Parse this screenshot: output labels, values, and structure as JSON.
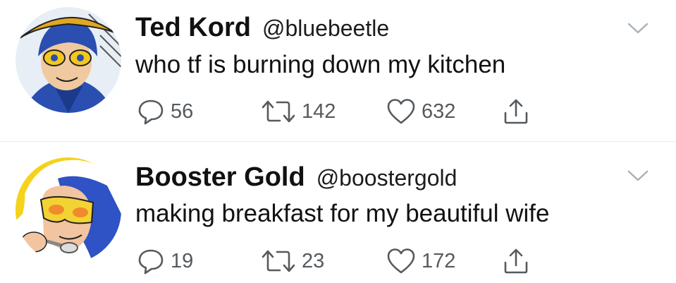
{
  "tweets": [
    {
      "display_name": "Ted Kord",
      "handle": "@bluebeetle",
      "text": "who tf is burning down my kitchen",
      "replies": "56",
      "retweets": "142",
      "likes": "632",
      "avatar_colors": {
        "bg": "#e8eef5",
        "mask": "#f2c81f",
        "suit": "#2a4fb0",
        "skin": "#f1c9a0"
      }
    },
    {
      "display_name": "Booster Gold",
      "handle": "@boostergold",
      "text": "making breakfast for my beautiful wife",
      "replies": "19",
      "retweets": "23",
      "likes": "172",
      "avatar_colors": {
        "bg": "#ffffff",
        "hair": "#f5d21c",
        "mask": "#2f52c4",
        "goggles": "#f3d233",
        "skin": "#f2c4a0"
      }
    }
  ],
  "icons": {
    "reply": "speech-bubble-icon",
    "retweet": "retweet-arrows-icon",
    "like": "heart-icon",
    "share": "share-up-arrow-icon",
    "caret": "chevron-down-icon"
  },
  "colors": {
    "text": "#111111",
    "secondary": "#555a5e",
    "divider": "#e6ecf0"
  }
}
